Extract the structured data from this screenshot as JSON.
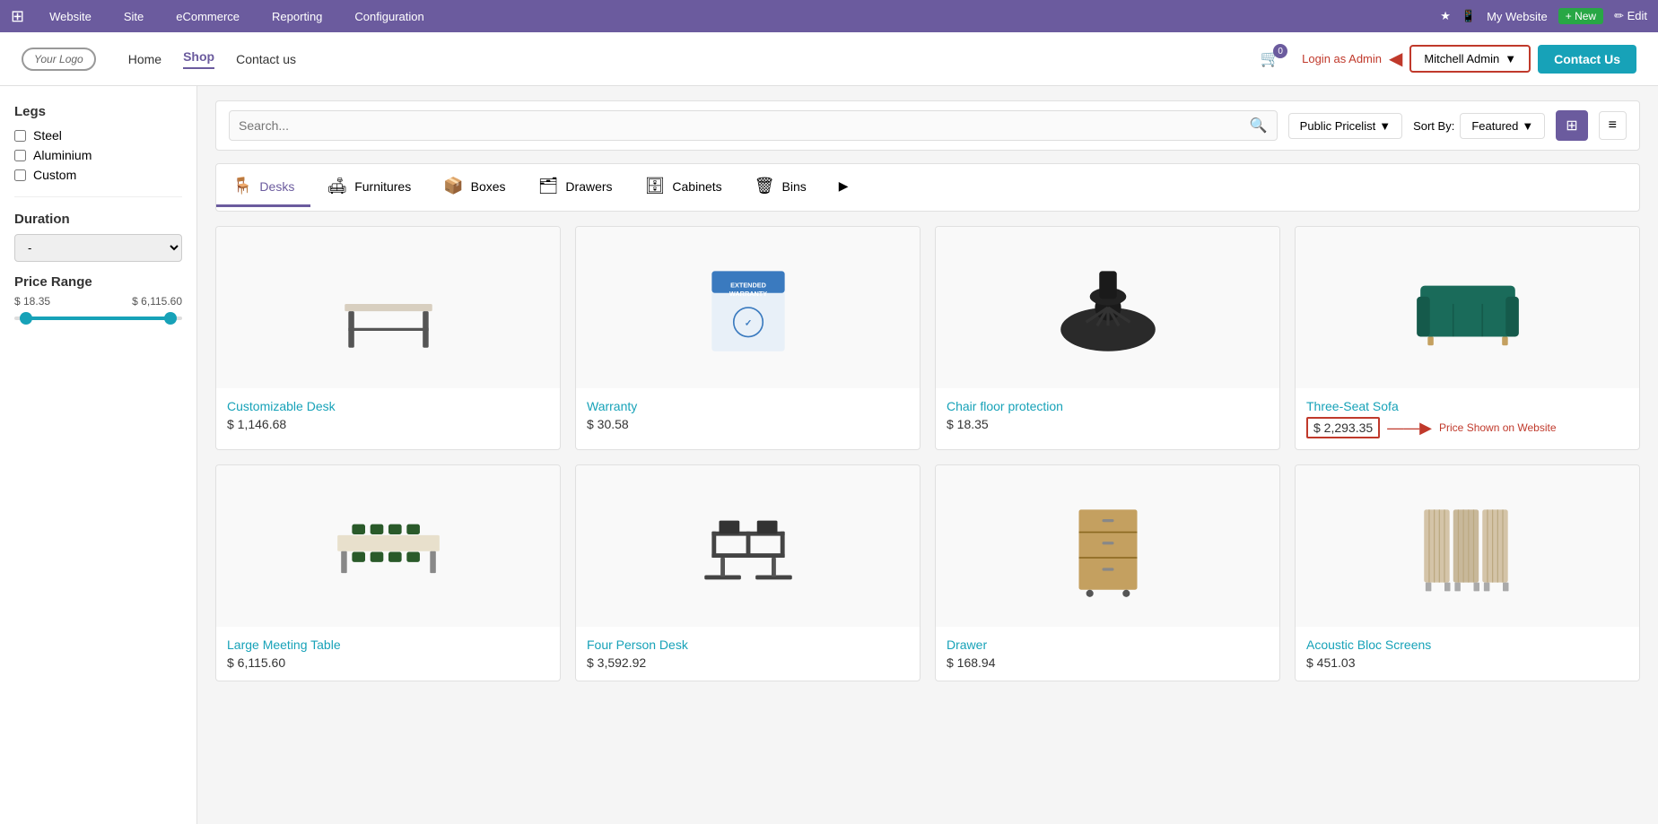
{
  "adminBar": {
    "appIcon": "⊞",
    "items": [
      "Website",
      "Site",
      "eCommerce",
      "Reporting",
      "Configuration"
    ],
    "rightItems": {
      "starIcon": "★",
      "mobileIcon": "📱",
      "myWebsite": "My Website",
      "newLabel": "+ New",
      "editLabel": "✏ Edit"
    }
  },
  "nav": {
    "logo": "Your Logo",
    "links": [
      "Home",
      "Shop",
      "Contact us"
    ],
    "activeLink": "Shop",
    "cartCount": "0",
    "loginAsAdmin": "Login as Admin",
    "mitchellAdmin": "Mitchell Admin",
    "contactUs": "Contact Us"
  },
  "sidebar": {
    "legsTitle": "Legs",
    "legsOptions": [
      "Steel",
      "Aluminium",
      "Custom"
    ],
    "durationTitle": "Duration",
    "durationDefault": "-",
    "priceRangeTitle": "Price Range",
    "priceMin": "$ 18.35",
    "priceMax": "$ 6,115.60"
  },
  "toolbar": {
    "searchPlaceholder": "Search...",
    "pricelist": "Public Pricelist",
    "sortByLabel": "Sort By:",
    "sortBy": "Featured",
    "gridViewLabel": "⊞",
    "listViewLabel": "≡"
  },
  "categories": [
    {
      "id": "desks",
      "label": "Desks",
      "active": true
    },
    {
      "id": "furnitures",
      "label": "Furnitures",
      "active": false
    },
    {
      "id": "boxes",
      "label": "Boxes",
      "active": false
    },
    {
      "id": "drawers",
      "label": "Drawers",
      "active": false
    },
    {
      "id": "cabinets",
      "label": "Cabinets",
      "active": false
    },
    {
      "id": "bins",
      "label": "Bins",
      "active": false
    }
  ],
  "products": [
    {
      "id": "customizable-desk",
      "name": "Customizable Desk",
      "price": "$ 1,146.68",
      "type": "desk",
      "color": "#e0d8cc"
    },
    {
      "id": "warranty",
      "name": "Warranty",
      "price": "$ 30.58",
      "type": "warranty",
      "color": "#dce8f5"
    },
    {
      "id": "chair-floor-protection",
      "name": "Chair floor protection",
      "price": "$ 18.35",
      "type": "mat",
      "color": "#333"
    },
    {
      "id": "three-seat-sofa",
      "name": "Three-Seat Sofa",
      "price": "$ 2,293.35",
      "highlighted": true,
      "type": "sofa",
      "color": "#1a6b5a",
      "annotation": "Price Shown on Website"
    },
    {
      "id": "large-meeting-table",
      "name": "Large Meeting Table",
      "price": "$ 6,115.60",
      "type": "meeting-table",
      "color": "#c8dcc8"
    },
    {
      "id": "four-person-desk",
      "name": "Four Person Desk",
      "price": "$ 3,592.92",
      "type": "four-person-desk",
      "color": "#555"
    },
    {
      "id": "drawer",
      "name": "Drawer",
      "price": "$ 168.94",
      "type": "drawer",
      "color": "#c4a060"
    },
    {
      "id": "acoustic-bloc-screens",
      "name": "Acoustic Bloc Screens",
      "price": "$ 451.03",
      "type": "screens",
      "color": "#d4c4a8"
    }
  ]
}
